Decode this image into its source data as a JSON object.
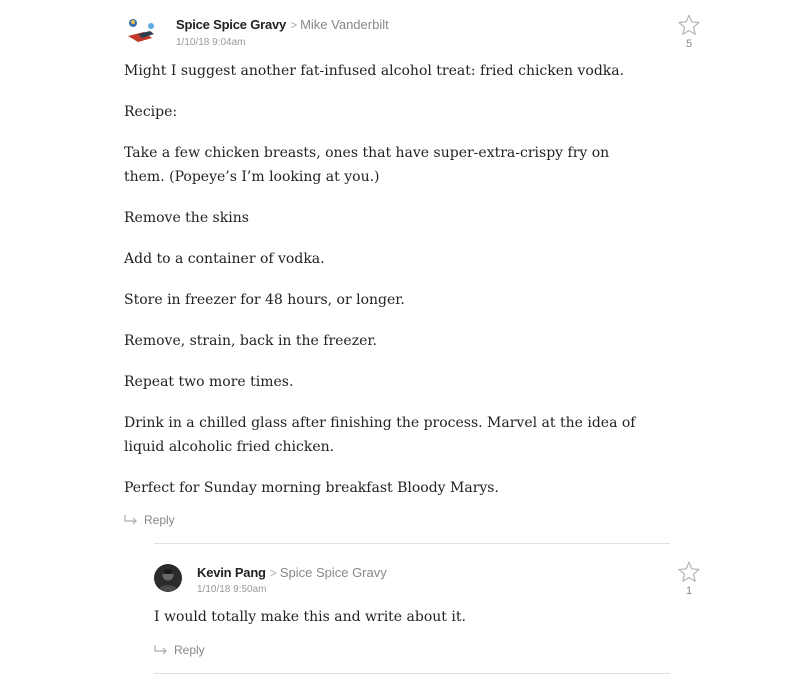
{
  "comments": [
    {
      "author": "Spice Spice Gravy",
      "reply_to": "Mike Vanderbilt",
      "timestamp": "1/10/18 9:04am",
      "stars": "5",
      "paragraphs": [
        "Might I suggest another fat-infused alcohol treat: fried chicken vodka.",
        "Recipe:",
        "Take a few chicken breasts, ones that have super-extra-crispy fry on them. (Popeye’s I’m looking at you.)",
        "Remove the skins",
        "Add to a container of vodka.",
        "Store in freezer for 48 hours, or longer.",
        "Remove, strain, back in the freezer.",
        "Repeat two more times.",
        "Drink in a chilled glass after finishing the process. Marvel at the idea of liquid alcoholic fried chicken.",
        "Perfect for Sunday morning breakfast Bloody Marys."
      ],
      "reply_label": "Reply"
    },
    {
      "author": "Kevin Pang",
      "reply_to": "Spice Spice Gravy",
      "timestamp": "1/10/18 9:50am",
      "stars": "1",
      "paragraphs": [
        "I would totally make this and write about it."
      ],
      "reply_label": "Reply"
    }
  ],
  "icons": {
    "chevron": "chevron-right-icon",
    "star": "star-outline-icon",
    "reply": "reply-arrow-icon"
  },
  "colors": {
    "text": "#222222",
    "muted": "#888888",
    "divider": "#e2e2e2"
  }
}
